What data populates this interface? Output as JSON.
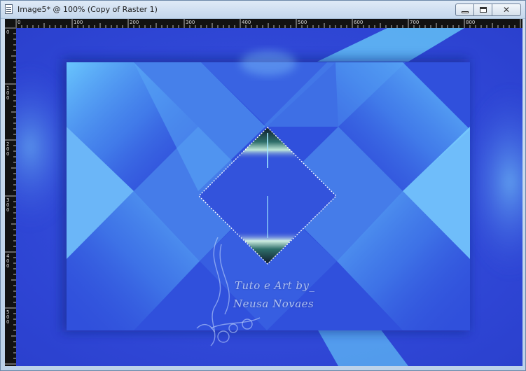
{
  "window": {
    "title": "Image5* @ 100% (Copy of Raster 1)",
    "controls": {
      "minimize": "minimize",
      "maximize": "maximize",
      "close": "close"
    }
  },
  "ruler": {
    "top_labels": [
      "0",
      "100",
      "200",
      "300",
      "400",
      "500",
      "600",
      "700",
      "800"
    ],
    "left_labels": [
      "0",
      "100",
      "200",
      "300",
      "400",
      "500"
    ]
  },
  "watermark": {
    "line1": "Tuto e Art by_",
    "line2": "Neusa Novaes"
  },
  "colors": {
    "base_blue": "#2f46d6",
    "light_blue": "#6fc8ff",
    "ruler_bg": "#121212",
    "selection": "#ffffff"
  },
  "icons": {
    "document": "document-icon",
    "minimize": "minimize-icon",
    "maximize": "maximize-icon",
    "close": "close-icon"
  }
}
